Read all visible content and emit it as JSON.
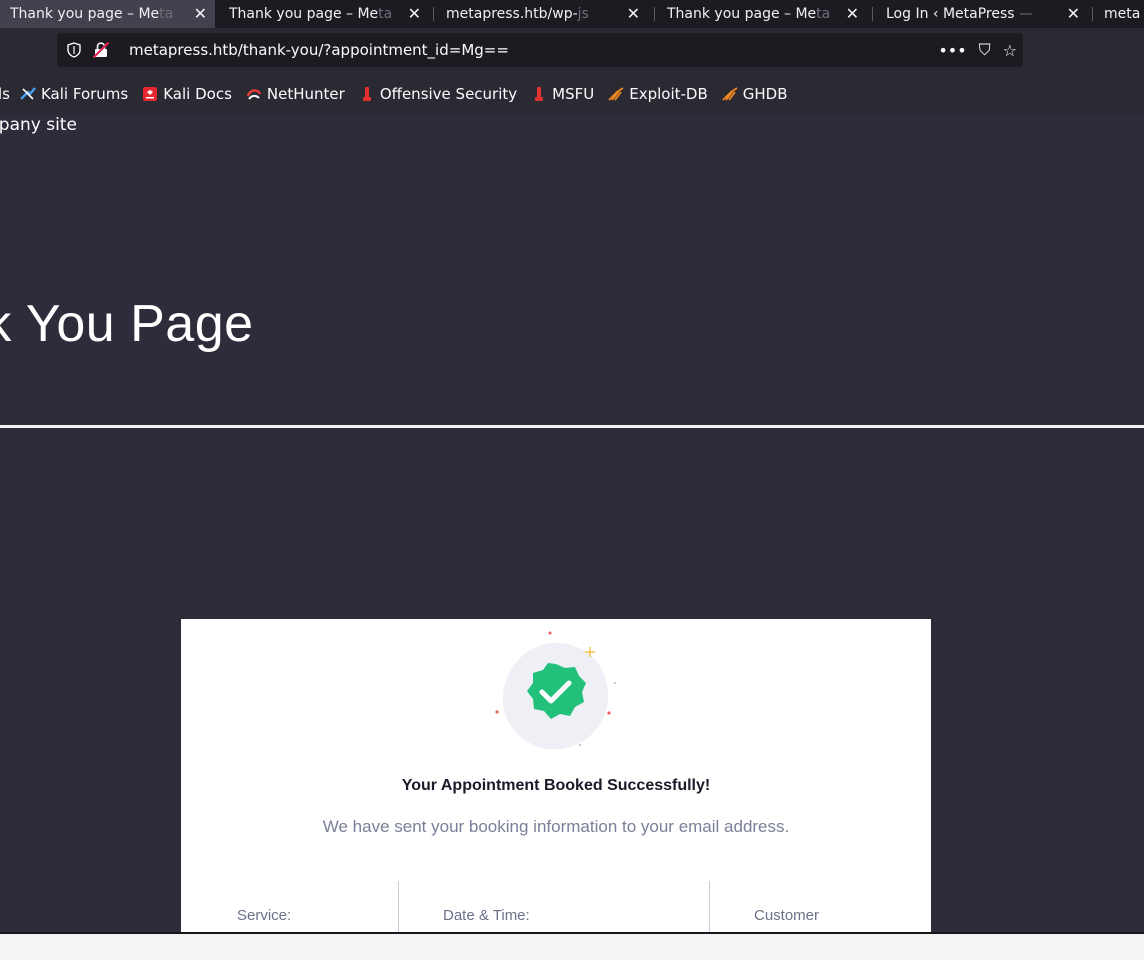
{
  "browser": {
    "tabs": [
      {
        "title": "Thank you page – Me",
        "fade": "ta",
        "active": true
      },
      {
        "title": "Thank you page – Me",
        "fade": "ta",
        "active": false
      },
      {
        "title": "metapress.htb/wp-",
        "fade": "js",
        "active": false
      },
      {
        "title": "Thank you page – Me",
        "fade": "ta",
        "active": false
      },
      {
        "title": "Log In ‹ MetaPress",
        "fade": " —",
        "active": false
      },
      {
        "title": "meta",
        "fade": "",
        "active": false
      }
    ],
    "close_glyph": "✕",
    "url": "metapress.htb/thank-you/?appointment_id=Mg==",
    "url_tools": {
      "more": "•••",
      "pocket": "⛉",
      "star": "☆"
    }
  },
  "bookmarks": [
    {
      "label": "ls",
      "icon": "none"
    },
    {
      "label": "Kali Forums",
      "icon": "kali-forums-icon"
    },
    {
      "label": "Kali Docs",
      "icon": "kali-docs-icon"
    },
    {
      "label": "NetHunter",
      "icon": "nethunter-icon"
    },
    {
      "label": "Offensive Security",
      "icon": "offsec-icon"
    },
    {
      "label": "MSFU",
      "icon": "msfu-icon"
    },
    {
      "label": "Exploit-DB",
      "icon": "exploit-db-icon"
    },
    {
      "label": "GHDB",
      "icon": "ghdb-icon"
    }
  ],
  "page": {
    "company_link": "npany site",
    "hero_title": "nk You Page",
    "card": {
      "title": "Your Appointment Booked Successfully!",
      "subtitle": "We have sent your booking information to your email address.",
      "columns": [
        "Service:",
        "Date & Time:",
        "Customer"
      ]
    }
  },
  "colors": {
    "page_bg": "#2c2c3b",
    "success_green": "#22c07a",
    "card_bg": "#ffffff"
  }
}
